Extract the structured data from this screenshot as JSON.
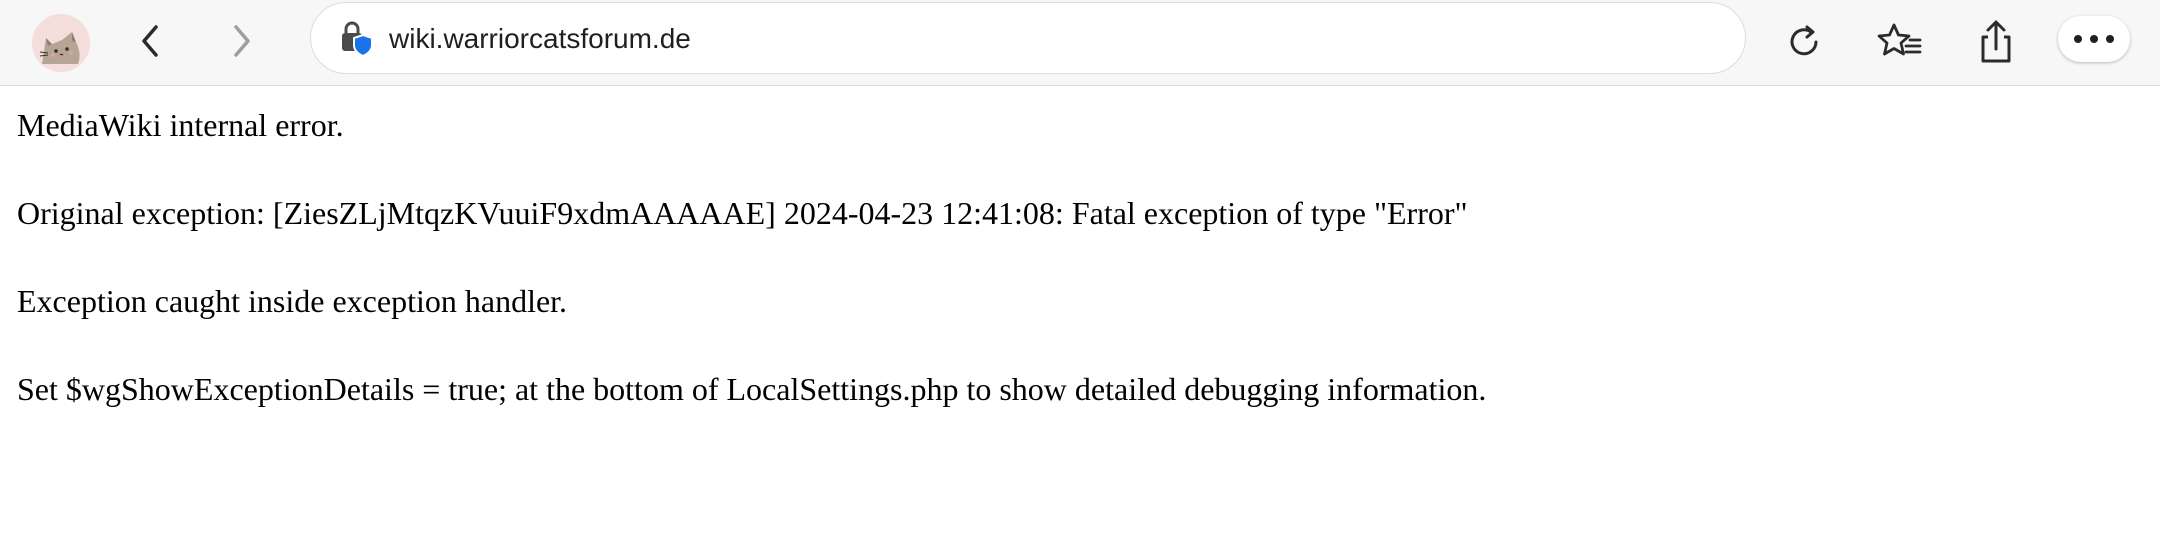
{
  "browser": {
    "url": "wiki.warriorcatsforum.de",
    "icons": {
      "avatar": "profile-cat-avatar",
      "back": "chevron-left-icon",
      "forward": "chevron-right-icon",
      "site": "site-security-icon",
      "reload": "reload-icon",
      "favorites": "favorites-star-list-icon",
      "share": "share-icon",
      "more": "more-dots-icon"
    },
    "colors": {
      "toolbar_bg": "#f7f7f7",
      "shield": "#1a73e8",
      "forward_disabled": "#9e9e9e"
    }
  },
  "page": {
    "lines": [
      "MediaWiki internal error.",
      "Original exception: [ZiesZLjMtqzKVuuiF9xdmAAAAAE] 2024-04-23 12:41:08: Fatal exception of type \"Error\"",
      "Exception caught inside exception handler.",
      "Set $wgShowExceptionDetails = true; at the bottom of LocalSettings.php to show detailed debugging information."
    ]
  }
}
